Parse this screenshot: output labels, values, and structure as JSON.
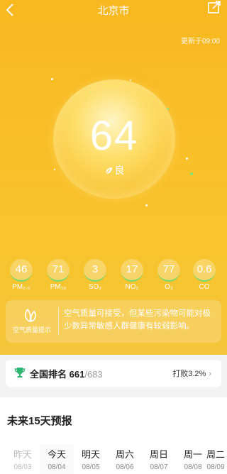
{
  "header": {
    "title": "北京市",
    "updated": "更新于09:00"
  },
  "aqi": {
    "value": "64",
    "level": "良"
  },
  "pollutants": [
    {
      "value": "46",
      "name": "PM₂.₅"
    },
    {
      "value": "71",
      "name": "PM₁₀"
    },
    {
      "value": "3",
      "name": "SO₂"
    },
    {
      "value": "17",
      "name": "NO₂"
    },
    {
      "value": "77",
      "name": "O₃"
    },
    {
      "value": "0.6",
      "name": "CO"
    }
  ],
  "tip": {
    "label": "空气质量提示",
    "text": "空气质量可接受，但某些污染物可能对极少数异常敏感人群健康有较弱影响。"
  },
  "rank": {
    "label": "全国排名",
    "value": "661",
    "total": "/683",
    "beat": "打败3.2%"
  },
  "forecast": {
    "title": "未来15天预报",
    "days": [
      {
        "name": "昨天",
        "date": "08/03"
      },
      {
        "name": "今天",
        "date": "08/04"
      },
      {
        "name": "明天",
        "date": "08/05"
      },
      {
        "name": "周六",
        "date": "08/06"
      },
      {
        "name": "周日",
        "date": "08/07"
      },
      {
        "name": "周一",
        "date": "08/08"
      },
      {
        "name": "周二",
        "date": "08/09"
      }
    ]
  },
  "colors": {
    "hero": "#f8b820",
    "accent_green": "#6edb6e"
  }
}
